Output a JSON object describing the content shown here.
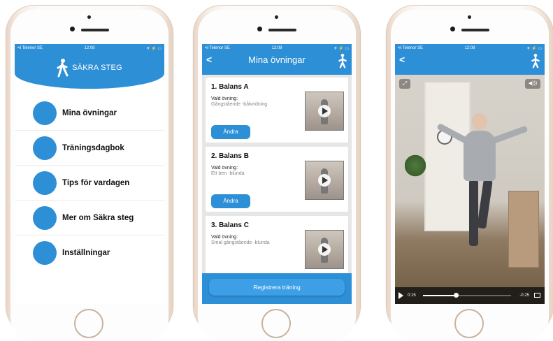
{
  "status": {
    "carrier": "•ıl Telenor SE",
    "time": "12:08",
    "right": "✈ ⚡ ▭"
  },
  "phone1": {
    "app_name": "SÄKRA STEG",
    "menu": [
      {
        "label": "Mina övningar"
      },
      {
        "label": "Träningsdagbok"
      },
      {
        "label": "Tips för vardagen"
      },
      {
        "label": "Mer om Säkra steg"
      },
      {
        "label": "Inställningar"
      }
    ]
  },
  "phone2": {
    "title": "Mina övningar",
    "cards": [
      {
        "title": "1. Balans A",
        "chosen_label": "Vald övning:",
        "chosen_value": "Gångstående -bålvridning",
        "button": "Ändra"
      },
      {
        "title": "2. Balans B",
        "chosen_label": "Vald övning:",
        "chosen_value": "Ett ben -blunda",
        "button": "Ändra"
      },
      {
        "title": "3. Balans C",
        "chosen_label": "Vald övning:",
        "chosen_value": "Smal gångstående -blunda",
        "button": "Ändra"
      }
    ],
    "register_button": "Registrera träning"
  },
  "phone3": {
    "video": {
      "time_elapsed": "0:15",
      "time_remaining": "-0:25",
      "progress": 0.375,
      "sound_icon": "◀)))"
    }
  },
  "colors": {
    "accent": "#2d8fd6",
    "list_bg": "#e6e6e6"
  },
  "icons": [
    "person-walking-icon",
    "back-chevron-icon",
    "play-icon",
    "expand-icon",
    "speaker-icon",
    "fullscreen-icon"
  ]
}
